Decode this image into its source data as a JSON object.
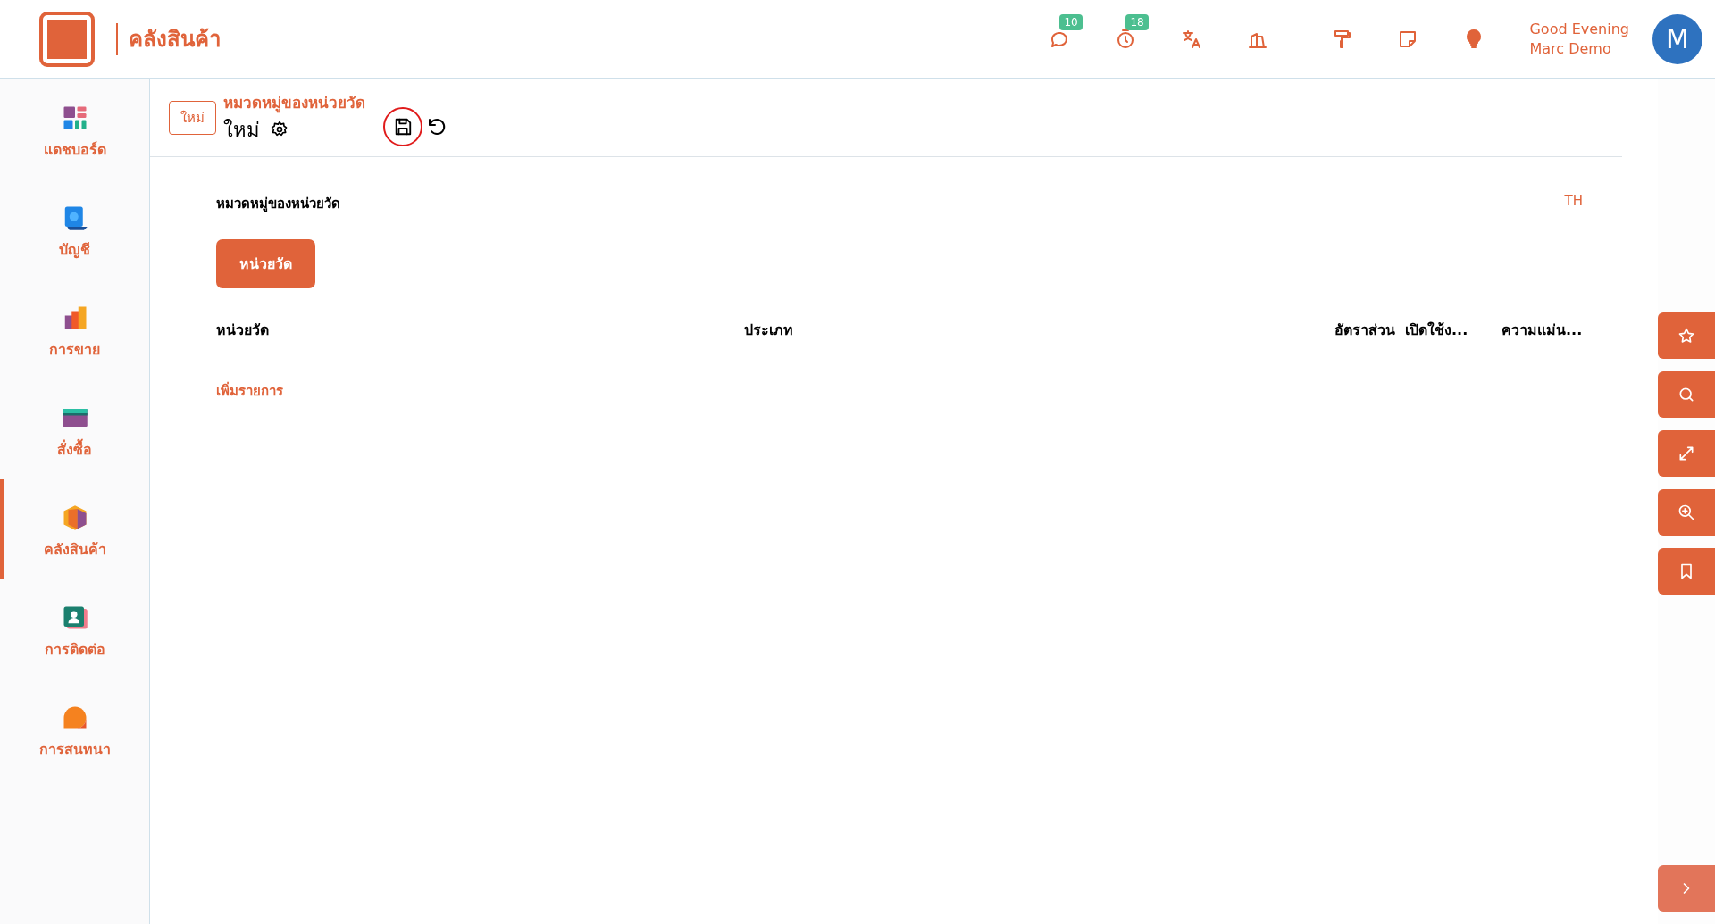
{
  "header": {
    "app_title": "คลังสินค้า",
    "notifications": [
      {
        "kind": "chat",
        "count": "10"
      },
      {
        "kind": "timer",
        "count": "18"
      }
    ],
    "greeting": "Good Evening",
    "user_name": "Marc Demo",
    "avatar_initial": "M"
  },
  "sidebar": {
    "items": [
      {
        "kind": "dashboard",
        "label": "แดชบอร์ด",
        "selected": false
      },
      {
        "kind": "accounting",
        "label": "บัญชี",
        "selected": false
      },
      {
        "kind": "sales",
        "label": "การขาย",
        "selected": false
      },
      {
        "kind": "purchase",
        "label": "สั่งซื้อ",
        "selected": false
      },
      {
        "kind": "inventory",
        "label": "คลังสินค้า",
        "selected": true
      },
      {
        "kind": "contacts",
        "label": "การติดต่อ",
        "selected": false
      },
      {
        "kind": "discuss",
        "label": "การสนทนา",
        "selected": false
      }
    ]
  },
  "control_panel": {
    "status_badge": "ใหม่",
    "breadcrumb": "หมวดหมู่ของหน่วยวัด",
    "record_title": "ใหม่",
    "save_highlighted": true
  },
  "form": {
    "section_label": "หมวดหมู่ของหน่วยวัด",
    "language": "TH",
    "tab": {
      "label": "หน่วยวัด",
      "selected": true
    },
    "table": {
      "columns": [
        "หน่วยวัด",
        "ประเภท",
        "อัตราส่วน",
        "เปิดใช้ง...",
        "ความแม่น..."
      ]
    },
    "add_line": "เพิ่มรายการ"
  }
}
